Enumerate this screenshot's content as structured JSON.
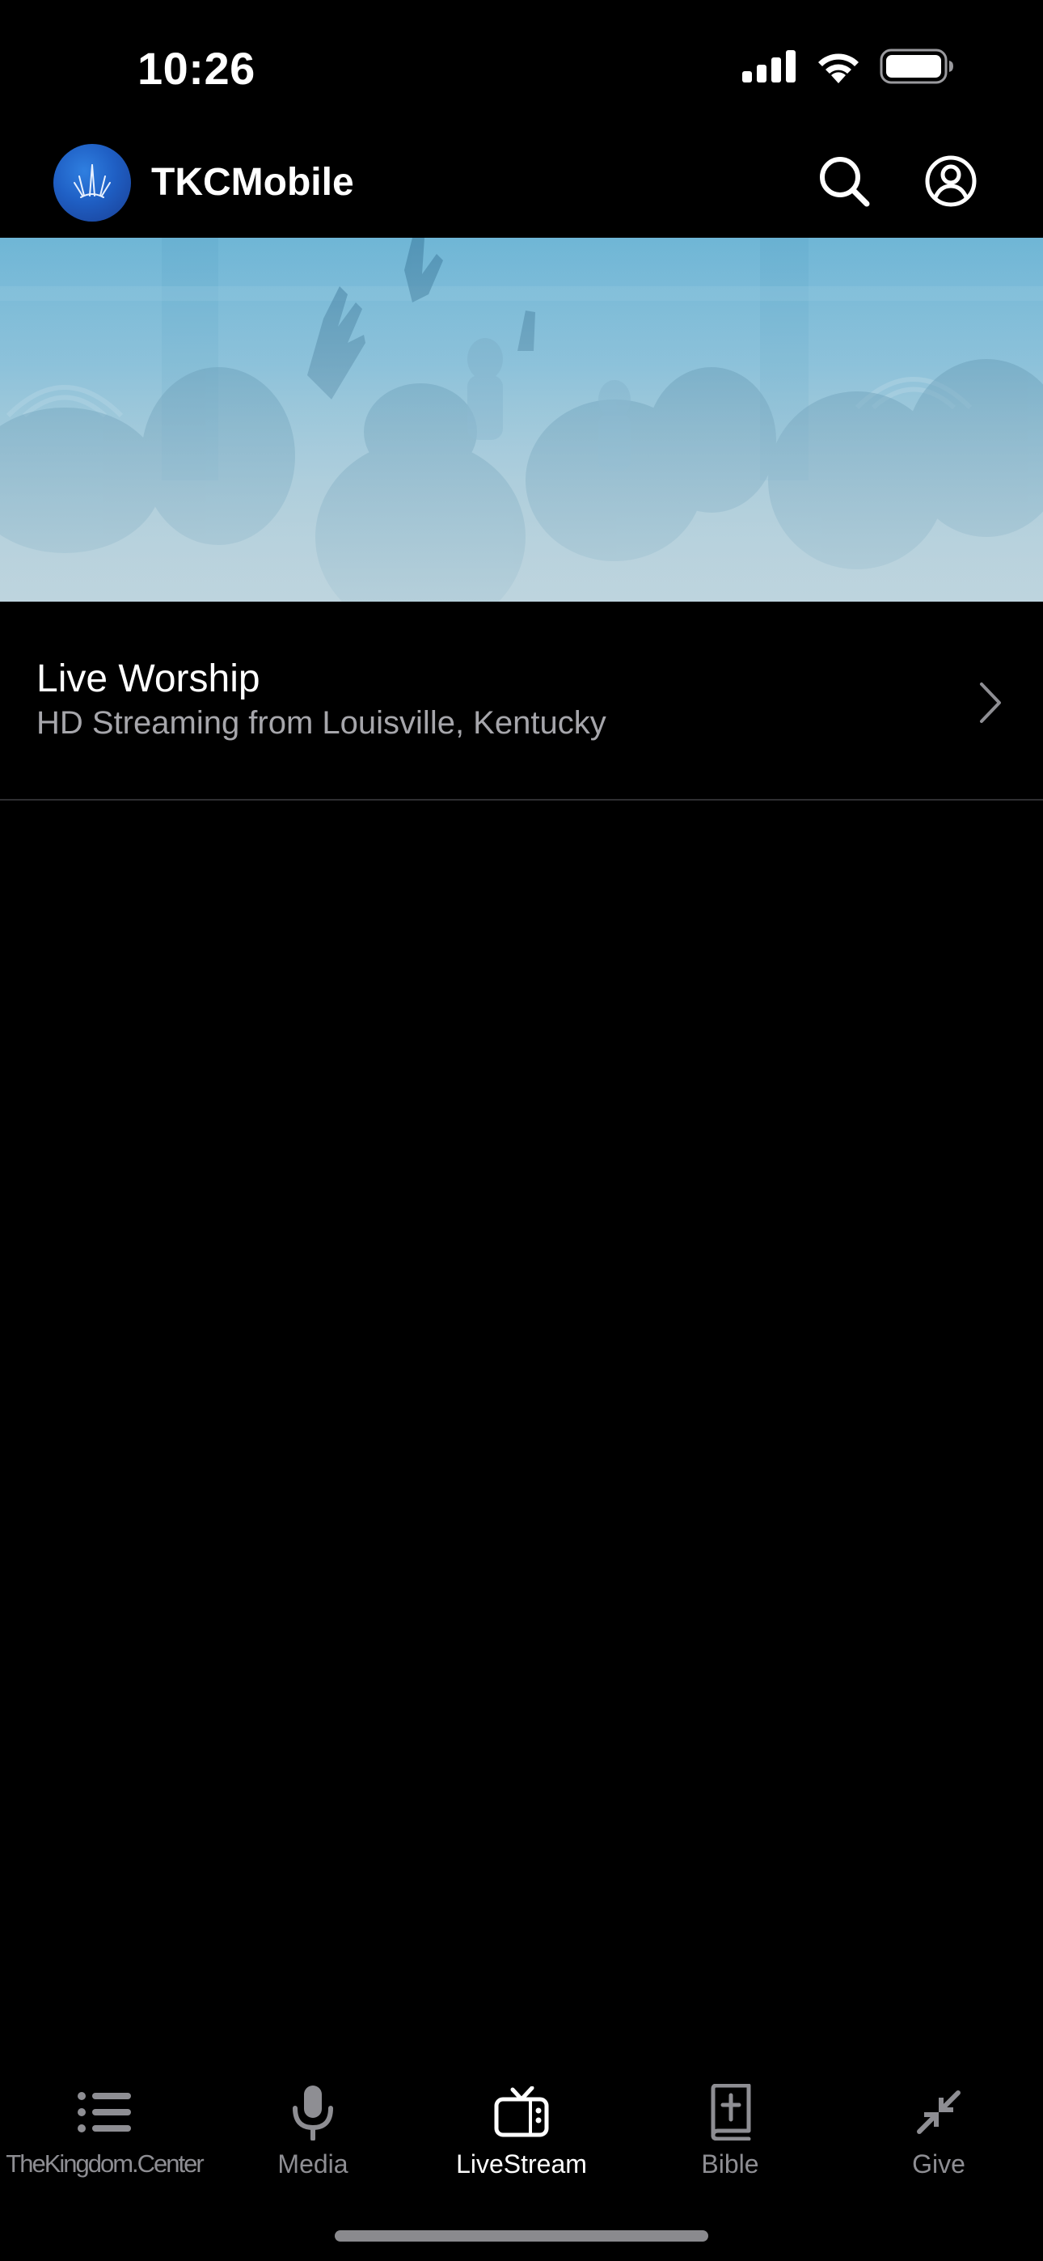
{
  "status_bar": {
    "time": "10:26",
    "icons": [
      "cellular-signal-icon",
      "wifi-icon",
      "battery-icon"
    ]
  },
  "header": {
    "app_name": "TKCMobile",
    "logo_icon": "crown-logo-icon",
    "actions": [
      {
        "name": "search",
        "icon": "search-icon"
      },
      {
        "name": "account",
        "icon": "user-circle-icon"
      }
    ]
  },
  "hero": {
    "image": "worship-crowd-banner",
    "tint_color": "#79bad8"
  },
  "list": {
    "items": [
      {
        "title": "Live Worship",
        "subtitle": "HD Streaming from Louisville, Kentucky",
        "accessory": "chevron-right-icon"
      }
    ]
  },
  "tab_bar": {
    "active_index": 2,
    "tabs": [
      {
        "label": "TheKingdom.Center",
        "icon": "list-icon"
      },
      {
        "label": "Media",
        "icon": "microphone-icon"
      },
      {
        "label": "LiveStream",
        "icon": "tv-icon"
      },
      {
        "label": "Bible",
        "icon": "bible-icon"
      },
      {
        "label": "Give",
        "icon": "collapse-arrows-icon"
      }
    ]
  },
  "colors": {
    "background": "#000000",
    "text_primary": "#ffffff",
    "text_secondary": "#a6a6ab",
    "tab_inactive": "#8e8e93",
    "logo_blue": "#1f5fc4"
  }
}
